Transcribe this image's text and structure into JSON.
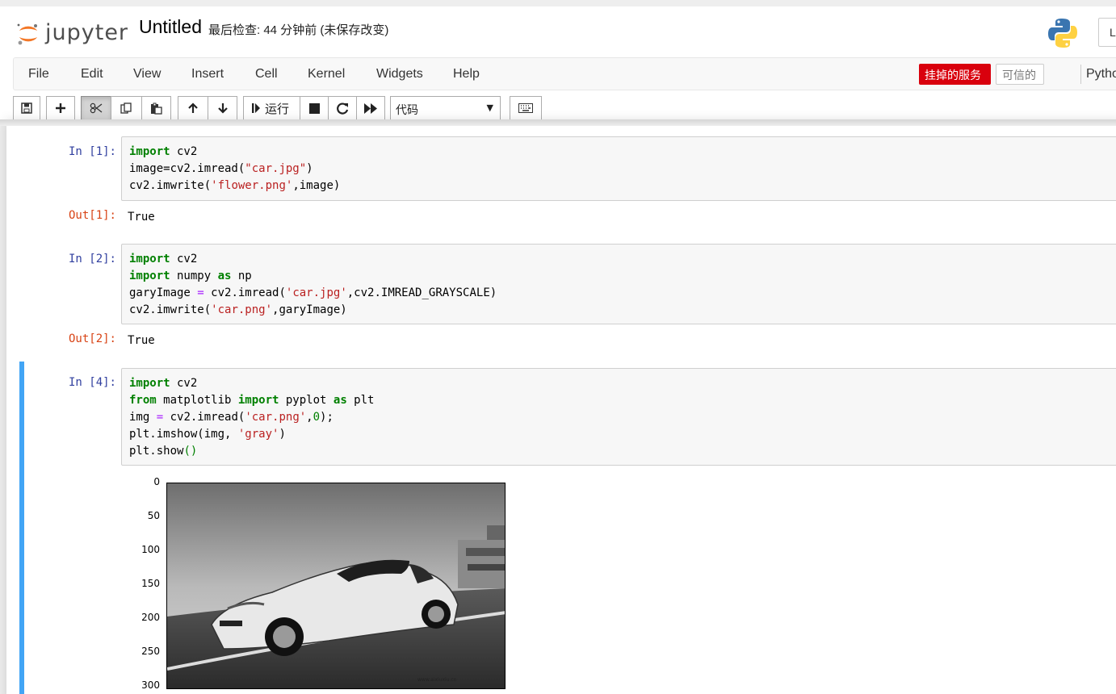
{
  "header": {
    "logo_text": "jupyter",
    "notebook_title": "Untitled",
    "checkpoint_text": "最后检查: 44 分钟前  (未保存改变)",
    "logout_label": "L"
  },
  "menu": {
    "items": [
      "File",
      "Edit",
      "View",
      "Insert",
      "Cell",
      "Kernel",
      "Widgets",
      "Help"
    ],
    "kernel_status_bad": "挂掉的服务",
    "trusted_label": "可信的",
    "kernel_name": "Pytho"
  },
  "toolbar": {
    "run_label": "运行",
    "cell_type": "代码",
    "icons": [
      "save-icon",
      "plus-icon",
      "cut-icon",
      "copy-icon",
      "paste-icon",
      "arrow-up-icon",
      "arrow-down-icon",
      "step-forward-icon",
      "stop-icon",
      "restart-icon",
      "fast-forward-icon",
      "keyboard-icon"
    ]
  },
  "cells": [
    {
      "in_prompt": "In  [1]:",
      "out_prompt": "Out[1]:",
      "output": "True"
    },
    {
      "in_prompt": "In  [2]:",
      "out_prompt": "Out[2]:",
      "output": "True"
    },
    {
      "in_prompt": "In  [4]:"
    }
  ],
  "code": {
    "c1_l1_kw": "import",
    "c1_l1_rest": " cv2",
    "c1_l2_a": "image=cv2.imread(",
    "c1_l2_s": "\"car.jpg\"",
    "c1_l2_b": ")",
    "c1_l3_a": "cv2.imwrite(",
    "c1_l3_s": "'flower.png'",
    "c1_l3_b": ",image)",
    "c2_l1_kw": "import",
    "c2_l1_rest": " cv2",
    "c2_l2_kw": "import",
    "c2_l2_mid": " numpy ",
    "c2_l2_kw2": "as",
    "c2_l2_rest": " np",
    "c2_l3_a": "garyImage ",
    "c2_l3_op": "=",
    "c2_l3_b": " cv2.imread(",
    "c2_l3_s": "'car.jpg'",
    "c2_l3_c": ",cv2.IMREAD_GRAYSCALE)",
    "c2_l4_a": "cv2.imwrite(",
    "c2_l4_s": "'car.png'",
    "c2_l4_b": ",garyImage)",
    "c3_l1_kw": "import",
    "c3_l1_rest": " cv2",
    "c3_l2_kw": "from",
    "c3_l2_mid": " matplotlib ",
    "c3_l2_kw2": "import",
    "c3_l2_mid2": " pyplot ",
    "c3_l2_kw3": "as",
    "c3_l2_rest": " plt",
    "c3_l3_a": "img ",
    "c3_l3_op": "=",
    "c3_l3_b": " cv2.imread(",
    "c3_l3_s": "'car.png'",
    "c3_l3_c": ",",
    "c3_l3_n": "0",
    "c3_l3_d": ");",
    "c3_l4_a": "plt.imshow(img, ",
    "c3_l4_s": "'gray'",
    "c3_l4_b": ")",
    "c3_l5_a": "plt.show",
    "c3_l5_p": "()"
  },
  "plot": {
    "yticks": [
      "0",
      "50",
      "100",
      "150",
      "200",
      "250",
      "300"
    ]
  }
}
